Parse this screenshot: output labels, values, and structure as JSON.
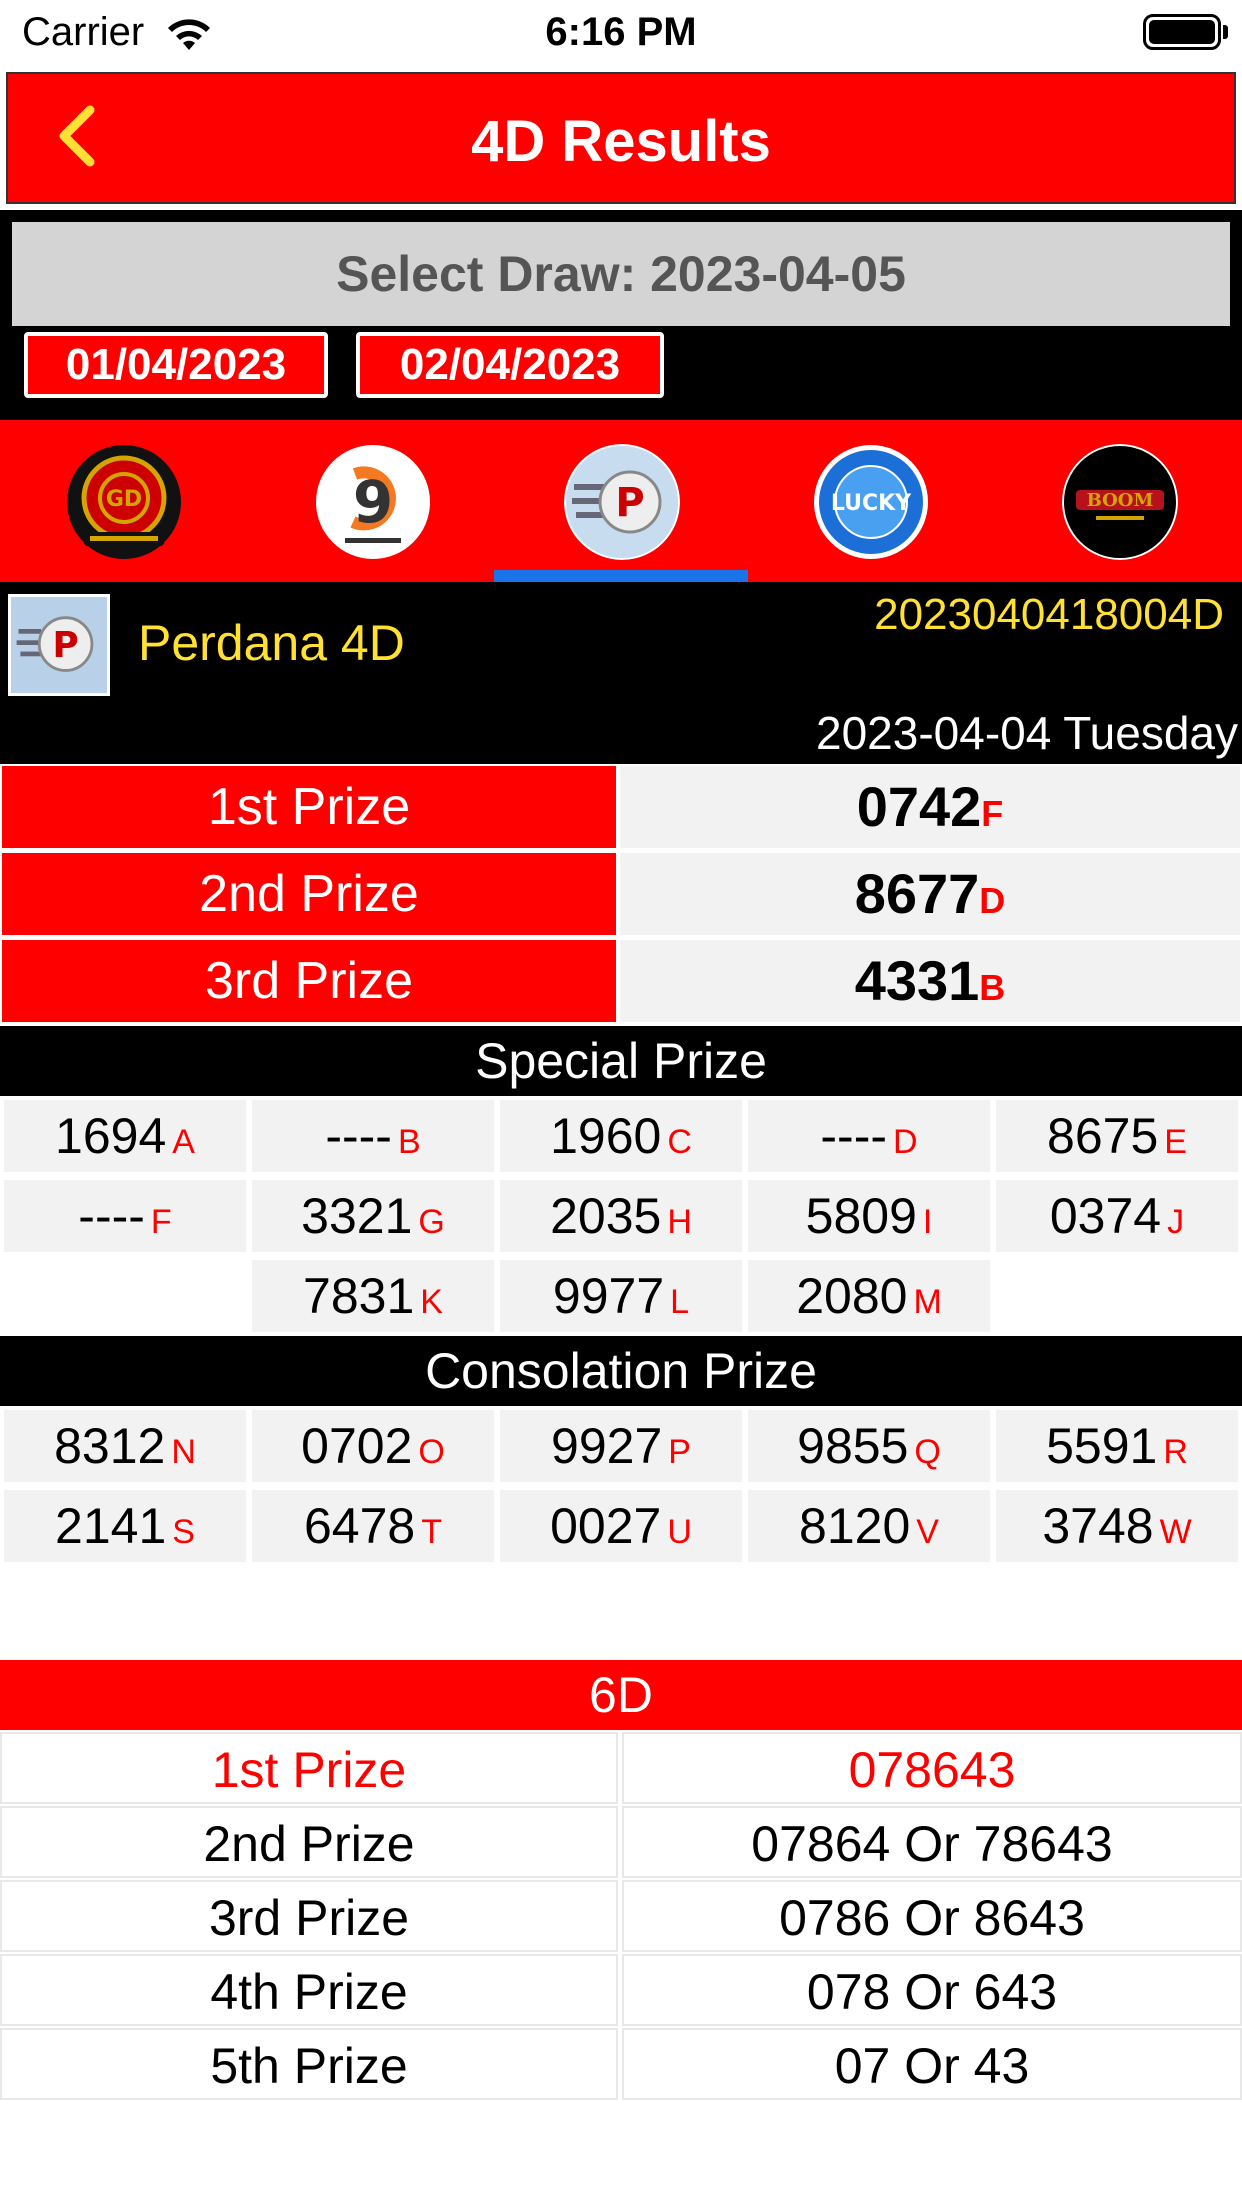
{
  "status_bar": {
    "carrier": "Carrier",
    "time": "6:16 PM"
  },
  "header": {
    "title": "4D Results"
  },
  "draw": {
    "select_label": "Select Draw: 2023-04-05",
    "dates": [
      "01/04/2023",
      "02/04/2023"
    ]
  },
  "logos": [
    {
      "icon": "grand-dragon-lotto-logo",
      "ring": "#c8a000",
      "bg": "#cc0000"
    },
    {
      "icon": "nine-lotto-logo",
      "ring": "#ffffff",
      "bg": "#ffffff"
    },
    {
      "icon": "perdana-logo",
      "ring": "#ffffff",
      "bg": "#b8d4ef"
    },
    {
      "icon": "lucky-hari-hari-logo",
      "ring": "#ffffff",
      "bg": "#1c6fd6"
    },
    {
      "icon": "boom-sabah-logo",
      "ring": "#c8a000",
      "bg": "#000000"
    }
  ],
  "colors": {
    "accent": "#ff0000",
    "indicator": "#1a73e8",
    "gold": "#ffe033"
  },
  "game": {
    "name": "Perdana 4D",
    "draw_no": "2023040418004D",
    "draw_date": "2023-04-04 Tuesday"
  },
  "top_prizes": [
    {
      "label": "1st Prize",
      "number": "0742",
      "suffix": "F"
    },
    {
      "label": "2nd Prize",
      "number": "8677",
      "suffix": "D"
    },
    {
      "label": "3rd Prize",
      "number": "4331",
      "suffix": "B"
    }
  ],
  "special": {
    "title": "Special Prize",
    "rows": [
      [
        {
          "n": "1694",
          "s": "A"
        },
        {
          "n": "----",
          "s": "B"
        },
        {
          "n": "1960",
          "s": "C"
        },
        {
          "n": "----",
          "s": "D"
        },
        {
          "n": "8675",
          "s": "E"
        }
      ],
      [
        {
          "n": "----",
          "s": "F"
        },
        {
          "n": "3321",
          "s": "G"
        },
        {
          "n": "2035",
          "s": "H"
        },
        {
          "n": "5809",
          "s": "I"
        },
        {
          "n": "0374",
          "s": "J"
        }
      ],
      [
        null,
        {
          "n": "7831",
          "s": "K"
        },
        {
          "n": "9977",
          "s": "L"
        },
        {
          "n": "2080",
          "s": "M"
        },
        null
      ]
    ]
  },
  "consolation": {
    "title": "Consolation Prize",
    "rows": [
      [
        {
          "n": "8312",
          "s": "N"
        },
        {
          "n": "0702",
          "s": "O"
        },
        {
          "n": "9927",
          "s": "P"
        },
        {
          "n": "9855",
          "s": "Q"
        },
        {
          "n": "5591",
          "s": "R"
        }
      ],
      [
        {
          "n": "2141",
          "s": "S"
        },
        {
          "n": "6478",
          "s": "T"
        },
        {
          "n": "0027",
          "s": "U"
        },
        {
          "n": "8120",
          "s": "V"
        },
        {
          "n": "3748",
          "s": "W"
        }
      ]
    ]
  },
  "sixd": {
    "title": "6D",
    "rows": [
      {
        "label": "1st Prize",
        "value": "078643",
        "highlight": true
      },
      {
        "label": "2nd Prize",
        "value": "07864 Or 78643",
        "highlight": false
      },
      {
        "label": "3rd Prize",
        "value": "0786 Or 8643",
        "highlight": false
      },
      {
        "label": "4th Prize",
        "value": "078 Or 643",
        "highlight": false
      },
      {
        "label": "5th Prize",
        "value": "07 Or 43",
        "highlight": false
      }
    ]
  }
}
